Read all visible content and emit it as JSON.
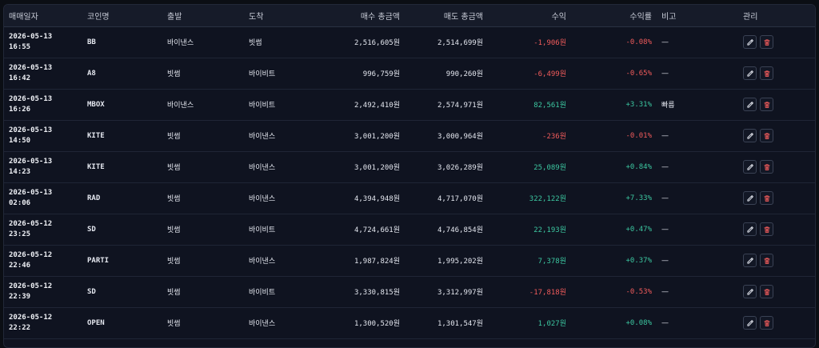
{
  "columns": [
    "매매일자",
    "코인명",
    "출발",
    "도착",
    "매수 총금액",
    "매도 총금액",
    "수익",
    "수익률",
    "비고",
    "관리"
  ],
  "colors": {
    "positive": "#3cc7a0",
    "negative": "#f05b5b",
    "edit_icon": "#e3e6ee",
    "delete_icon": "#f05b5b"
  },
  "icons": {
    "edit": "pencil-icon",
    "delete": "trash-icon"
  },
  "rows": [
    {
      "date": "2026-05-13",
      "time": "16:55",
      "coin": "BB",
      "from": "바이낸스",
      "to": "빗썸",
      "buy": "2,516,605원",
      "sell": "2,514,699원",
      "profit": "-1,906원",
      "rate": "-0.08%",
      "note": "—",
      "sign": "neg"
    },
    {
      "date": "2026-05-13",
      "time": "16:42",
      "coin": "A8",
      "from": "빗썸",
      "to": "바이비트",
      "buy": "996,759원",
      "sell": "990,260원",
      "profit": "-6,499원",
      "rate": "-0.65%",
      "note": "—",
      "sign": "neg"
    },
    {
      "date": "2026-05-13",
      "time": "16:26",
      "coin": "MBOX",
      "from": "바이낸스",
      "to": "바이비트",
      "buy": "2,492,410원",
      "sell": "2,574,971원",
      "profit": "82,561원",
      "rate": "+3.31%",
      "note": "빠름",
      "sign": "pos"
    },
    {
      "date": "2026-05-13",
      "time": "14:50",
      "coin": "KITE",
      "from": "빗썸",
      "to": "바이낸스",
      "buy": "3,001,200원",
      "sell": "3,000,964원",
      "profit": "-236원",
      "rate": "-0.01%",
      "note": "—",
      "sign": "neg"
    },
    {
      "date": "2026-05-13",
      "time": "14:23",
      "coin": "KITE",
      "from": "빗썸",
      "to": "바이낸스",
      "buy": "3,001,200원",
      "sell": "3,026,289원",
      "profit": "25,089원",
      "rate": "+0.84%",
      "note": "—",
      "sign": "pos"
    },
    {
      "date": "2026-05-13",
      "time": "02:06",
      "coin": "RAD",
      "from": "빗썸",
      "to": "바이낸스",
      "buy": "4,394,948원",
      "sell": "4,717,070원",
      "profit": "322,122원",
      "rate": "+7.33%",
      "note": "—",
      "sign": "pos"
    },
    {
      "date": "2026-05-12",
      "time": "23:25",
      "coin": "SD",
      "from": "빗썸",
      "to": "바이비트",
      "buy": "4,724,661원",
      "sell": "4,746,854원",
      "profit": "22,193원",
      "rate": "+0.47%",
      "note": "—",
      "sign": "pos"
    },
    {
      "date": "2026-05-12",
      "time": "22:46",
      "coin": "PARTI",
      "from": "빗썸",
      "to": "바이낸스",
      "buy": "1,987,824원",
      "sell": "1,995,202원",
      "profit": "7,378원",
      "rate": "+0.37%",
      "note": "—",
      "sign": "pos"
    },
    {
      "date": "2026-05-12",
      "time": "22:39",
      "coin": "SD",
      "from": "빗썸",
      "to": "바이비트",
      "buy": "3,330,815원",
      "sell": "3,312,997원",
      "profit": "-17,818원",
      "rate": "-0.53%",
      "note": "—",
      "sign": "neg"
    },
    {
      "date": "2026-05-12",
      "time": "22:22",
      "coin": "OPEN",
      "from": "빗썸",
      "to": "바이낸스",
      "buy": "1,300,520원",
      "sell": "1,301,547원",
      "profit": "1,027원",
      "rate": "+0.08%",
      "note": "—",
      "sign": "pos"
    }
  ]
}
